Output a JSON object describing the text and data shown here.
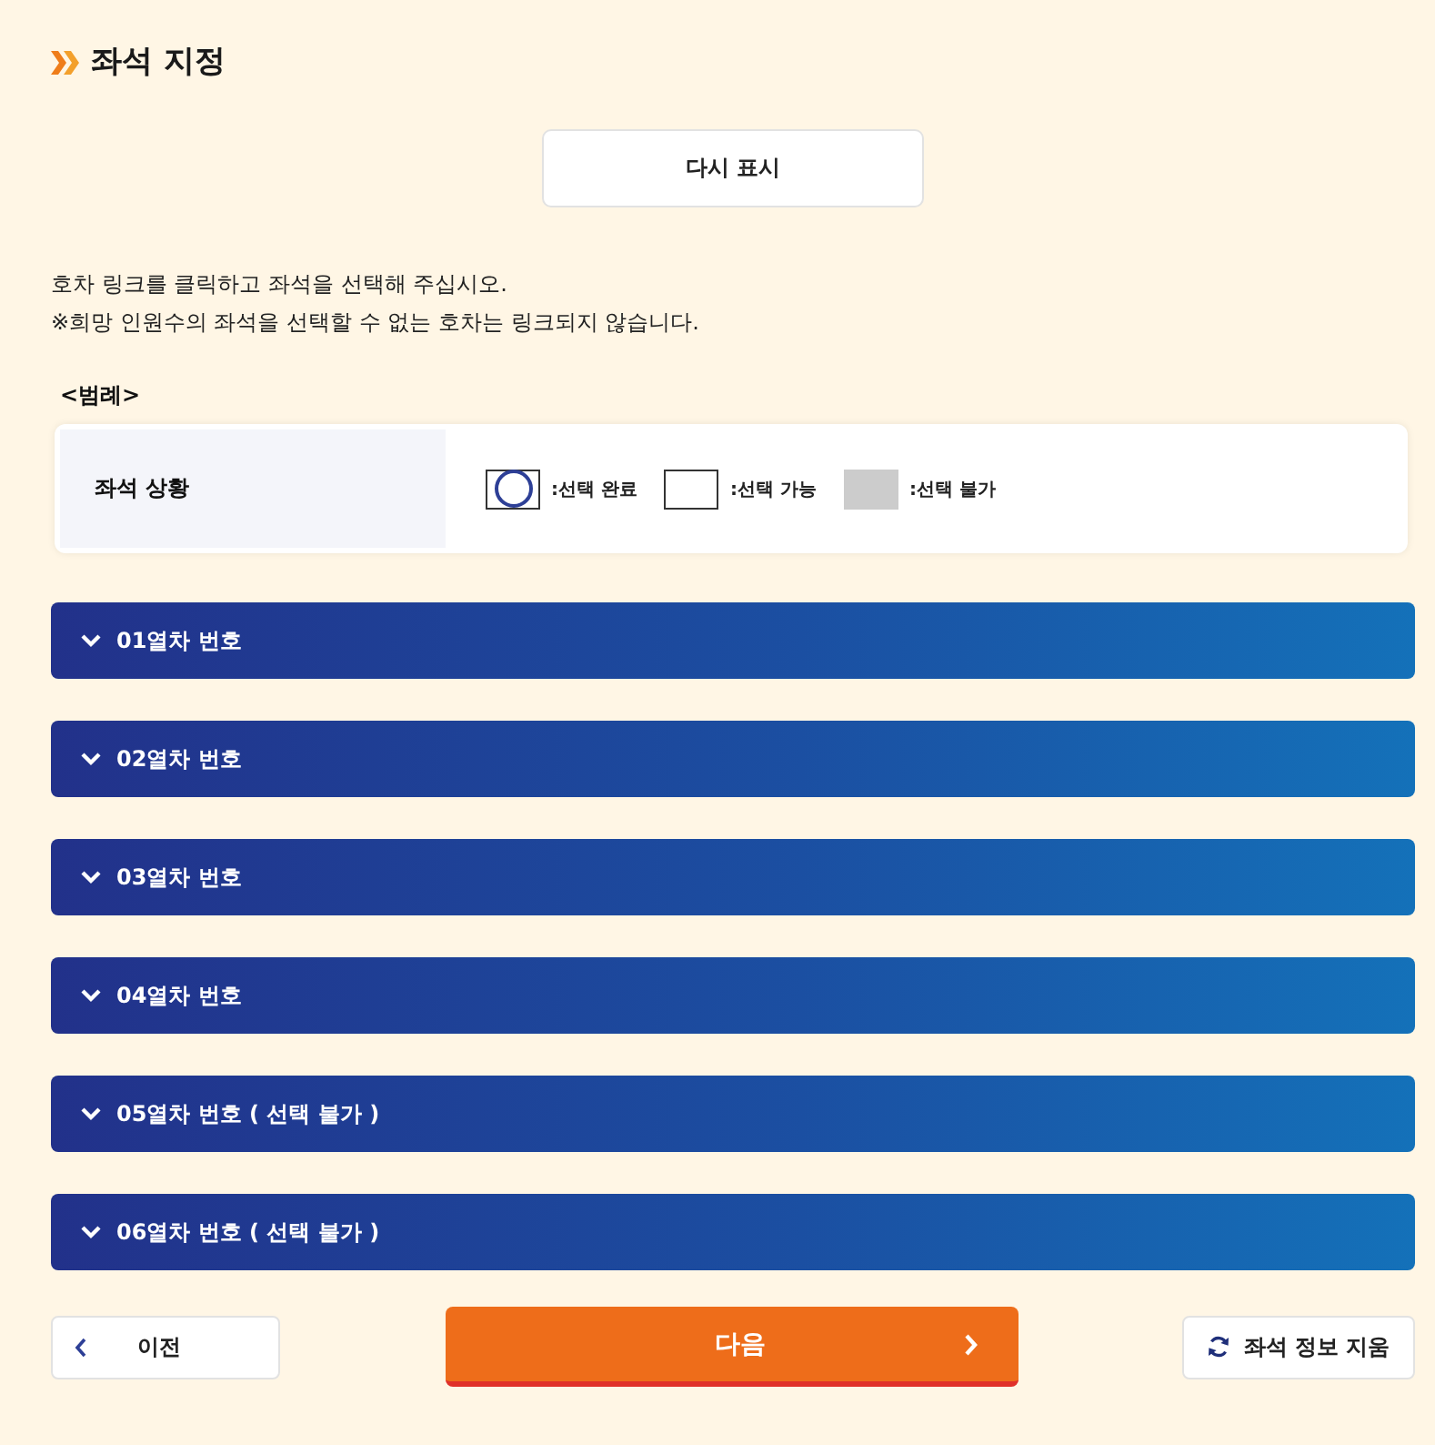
{
  "header": {
    "title": "좌석 지정"
  },
  "redisplay_button": "다시 표시",
  "instructions": [
    "호차 링크를 클릭하고 좌석을 선택해 주십시오.",
    "※희망 인원수의 좌석을 선택할 수 없는 호차는 링크되지 않습니다."
  ],
  "legend": {
    "heading": "<범례>",
    "row_label": "좌석 상황",
    "items": [
      {
        "kind": "selected",
        "label": ":선택 완료"
      },
      {
        "kind": "available",
        "label": ":선택 가능"
      },
      {
        "kind": "unavailable",
        "label": ":선택 불가"
      }
    ]
  },
  "cars": [
    {
      "label": "01열차 번호",
      "expanded": false
    },
    {
      "label": "02열차 번호",
      "expanded": false
    },
    {
      "label": "03열차 번호",
      "expanded": false
    },
    {
      "label": "04열차 번호",
      "expanded": false
    },
    {
      "label": "05열차 번호 ( 선택 불가 )",
      "expanded": false
    },
    {
      "label": "06열차 번호 ( 선택 불가 )",
      "expanded": false
    }
  ],
  "footer": {
    "prev_button": "이전",
    "next_button": "다음",
    "clear_button": "좌석 정보 지움"
  }
}
